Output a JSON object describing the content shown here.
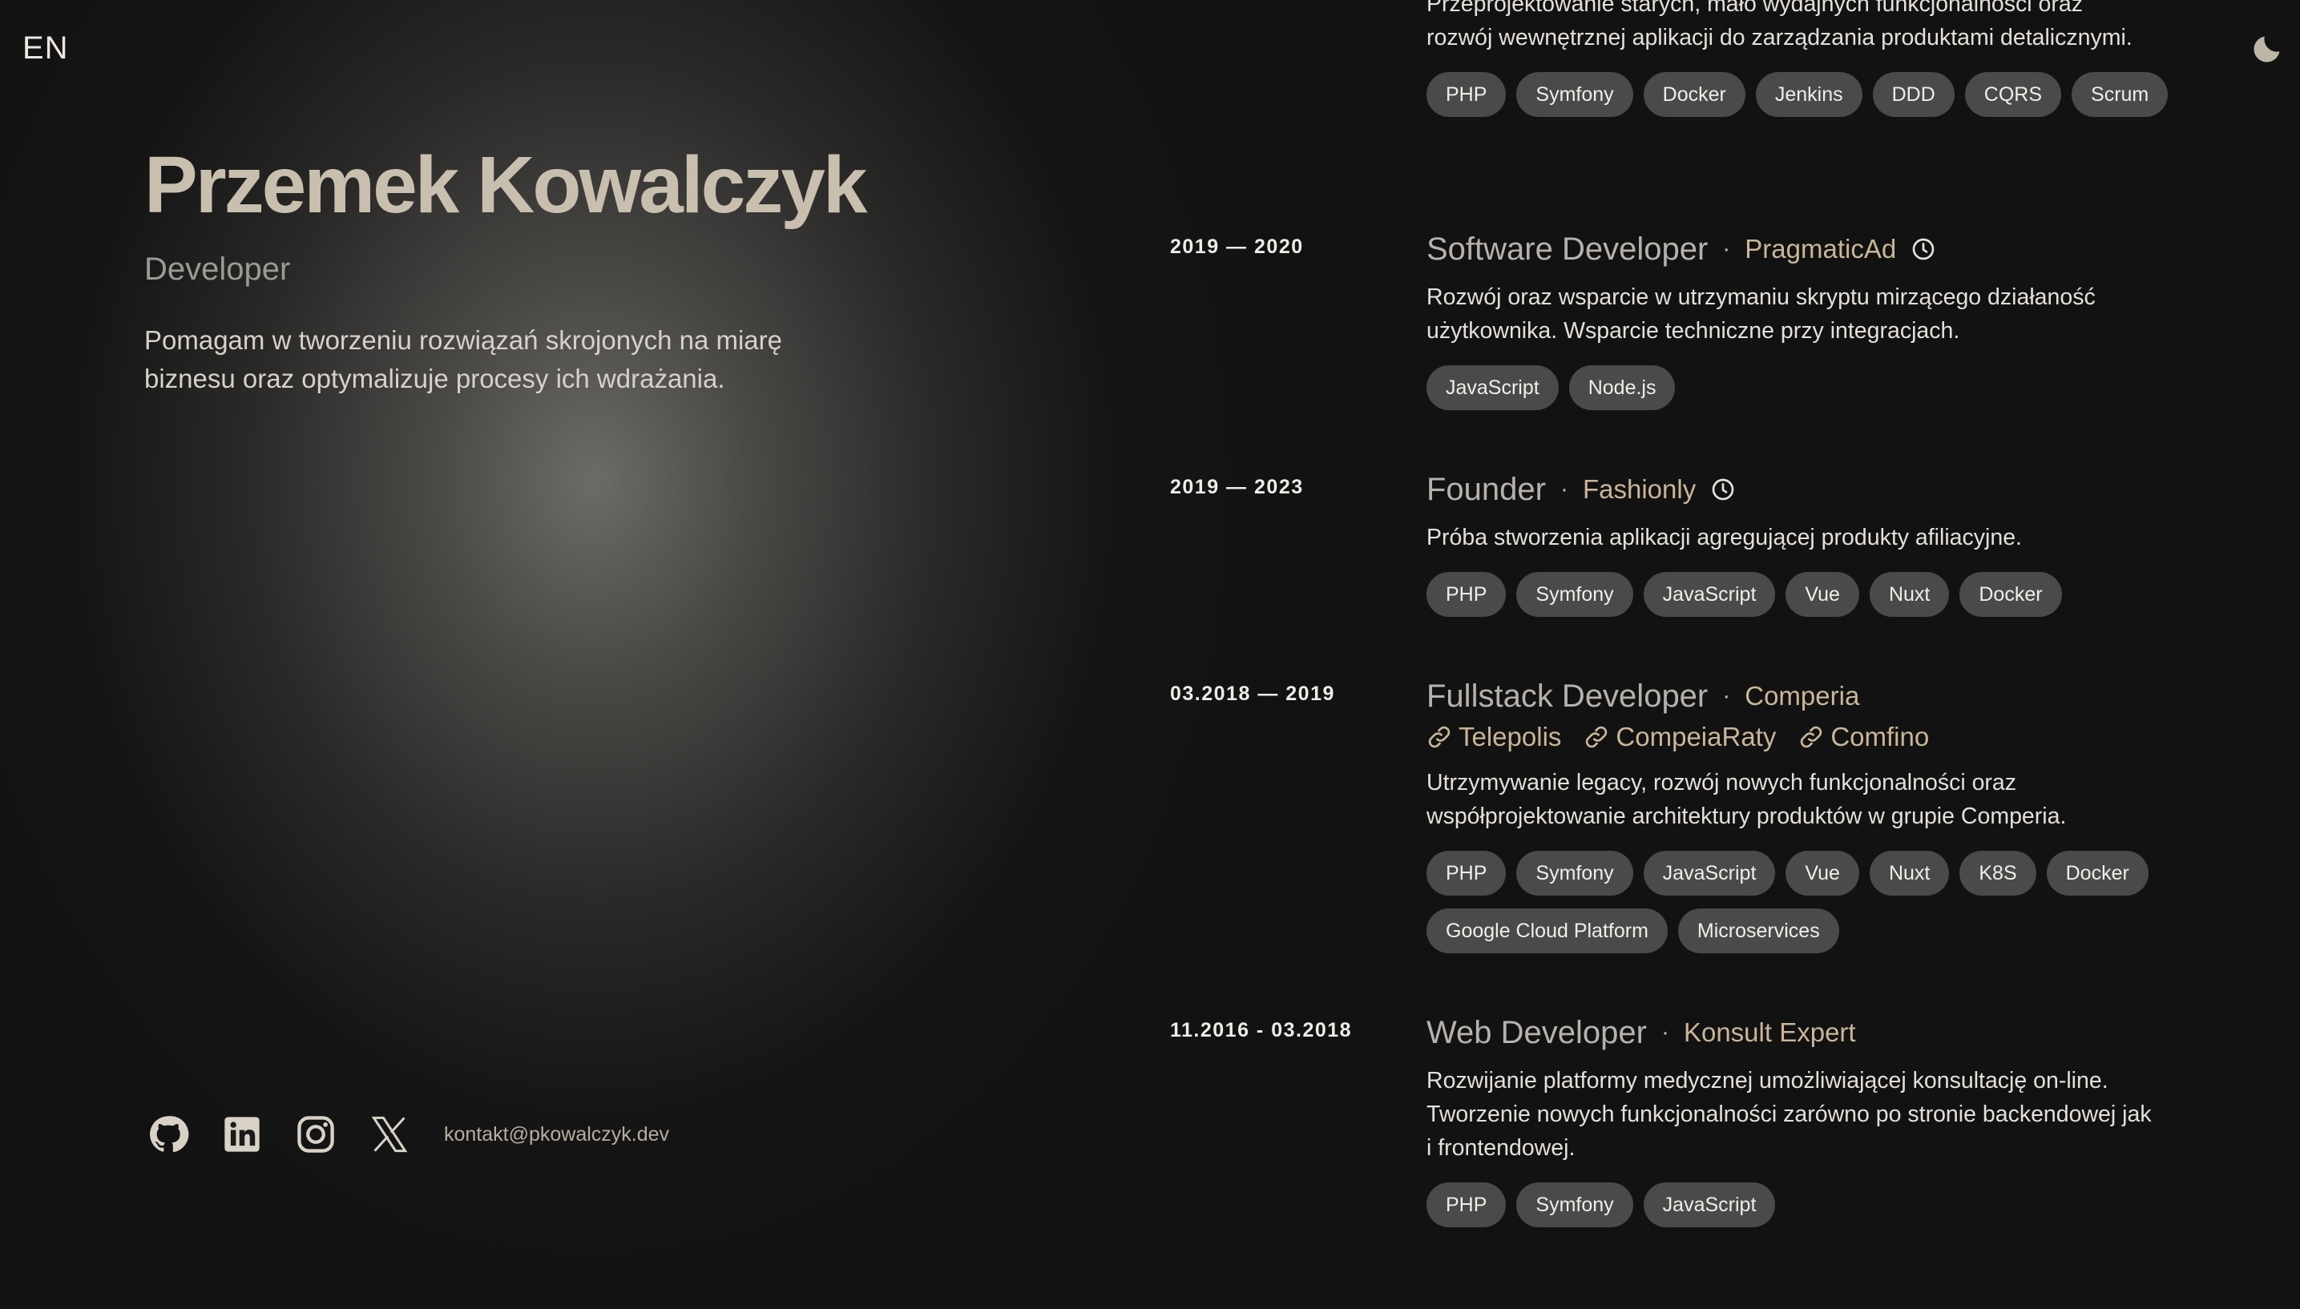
{
  "header": {
    "lang": "EN",
    "theme_icon": "moon-icon"
  },
  "hero": {
    "name": "Przemek Kowalczyk",
    "role": "Developer",
    "desc_line1": "Pomagam w tworzeniu rozwiązań skrojonych na miarę",
    "desc_line2": "biznesu oraz optymalizuje procesy ich wdrażania."
  },
  "socials": {
    "icons": [
      "github-icon",
      "linkedin-icon",
      "instagram-icon",
      "x-icon"
    ],
    "email": "kontakt@pkowalczyk.dev"
  },
  "jobs": [
    {
      "desc_line1": "Przeprojektowanie starych, mało wydajnych funkcjonalności oraz",
      "desc_line2": "rozwój wewnętrznej aplikacji do zarządzania produktami detalicznymi.",
      "tags": [
        "PHP",
        "Symfony",
        "Docker",
        "Jenkins",
        "DDD",
        "CQRS",
        "Scrum"
      ]
    },
    {
      "date": "2019 — 2020",
      "title": "Software Developer",
      "company": "PragmaticAd",
      "desc_line1": "Rozwój oraz wsparcie w utrzymaniu skryptu mirzącego działaność",
      "desc_line2": "użytkownika. Wsparcie techniczne przy integracjach.",
      "tags": [
        "JavaScript",
        "Node.js"
      ]
    },
    {
      "date": "2019 — 2023",
      "title": "Founder",
      "company": "Fashionly",
      "desc_line1": "Próba stworzenia aplikacji agregującej produkty afiliacyjne.",
      "tags": [
        "PHP",
        "Symfony",
        "JavaScript",
        "Vue",
        "Nuxt",
        "Docker"
      ]
    },
    {
      "date": "03.2018 — 2019",
      "title": "Fullstack Developer",
      "company": "Comperia",
      "links": [
        "Telepolis",
        "CompeiaRaty",
        "Comfino"
      ],
      "desc_line1": "Utrzymywanie legacy, rozwój nowych funkcjonalności oraz",
      "desc_line2": "współprojektowanie architektury produktów w grupie Comperia.",
      "tags": [
        "PHP",
        "Symfony",
        "JavaScript",
        "Vue",
        "Nuxt",
        "K8S",
        "Docker",
        "Google Cloud Platform",
        "Microservices"
      ]
    },
    {
      "date": "11.2016 - 03.2018",
      "title": "Web Developer",
      "company": "Konsult Expert",
      "desc_line1": "Rozwijanie platformy medycznej umożliwiającej konsultację on-line.",
      "desc_line2": "Tworzenie nowych funkcjonalności zarówno po stronie backendowej jak",
      "desc_line3": "i frontendowej.",
      "tags": [
        "PHP",
        "Symfony",
        "JavaScript"
      ]
    }
  ]
}
